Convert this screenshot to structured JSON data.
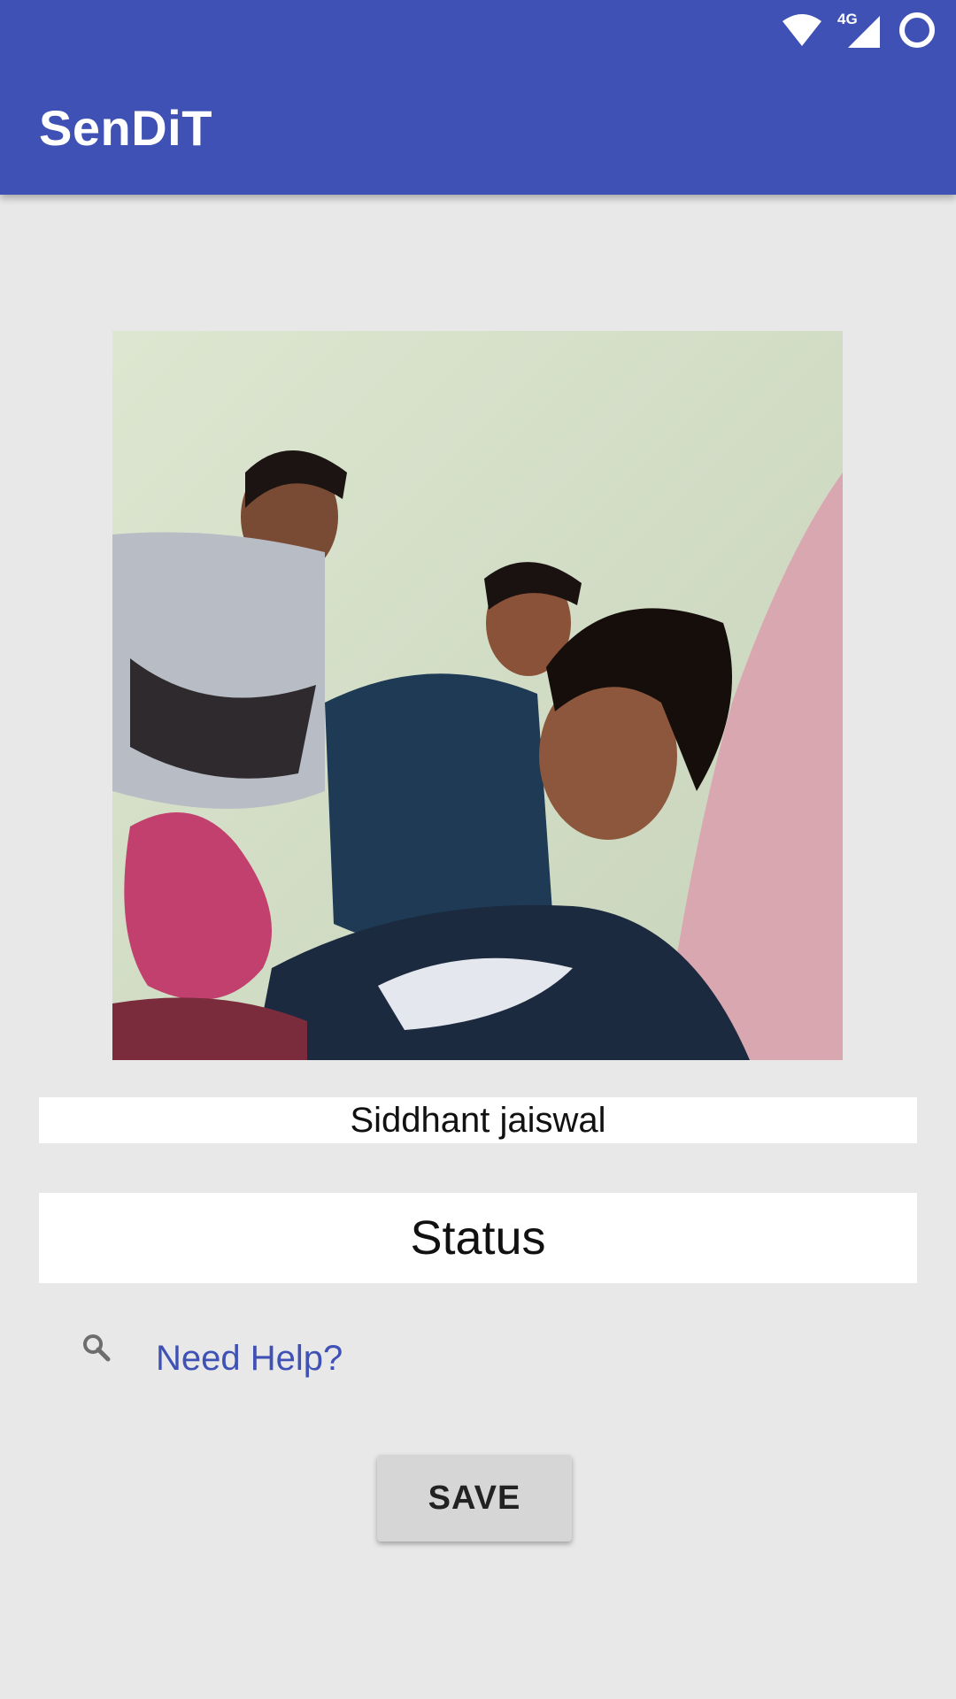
{
  "status_bar": {
    "network_label": "4G",
    "icons": [
      "wifi-icon",
      "cellular-signal-icon",
      "battery-ring-icon"
    ]
  },
  "app_bar": {
    "title": "SenDiT",
    "color": "#3f51b5"
  },
  "profile": {
    "photo_description_icon": "profile-photo",
    "name_value": "Siddhant jaiswal",
    "status_placeholder": "Status"
  },
  "help": {
    "icon": "search-icon",
    "label": "Need Help?",
    "link_color": "#3f51b5"
  },
  "actions": {
    "save_label": "SAVE"
  }
}
